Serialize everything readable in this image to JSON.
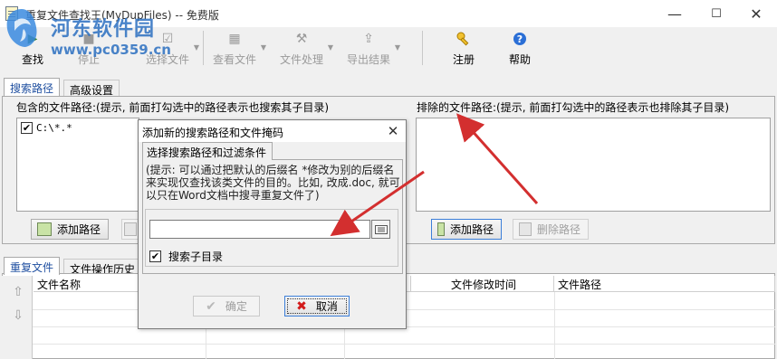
{
  "window": {
    "title": "重复文件查找王(MyDupFiles) -- 免费版",
    "minimize_glyph": "—",
    "maximize_glyph": "☐",
    "close_glyph": "✕"
  },
  "watermark": {
    "title": "河东软件园",
    "url": "www.pc0359.cn"
  },
  "toolbar": {
    "find": {
      "label": "查找",
      "icon": "play-icon"
    },
    "stop": {
      "label": "停止",
      "icon": "stop-icon"
    },
    "select_files": {
      "label": "选择文件",
      "icon": "checkbox-list-icon"
    },
    "view_files": {
      "label": "查看文件",
      "icon": "grid-icon"
    },
    "file_process": {
      "label": "文件处理",
      "icon": "tools-icon"
    },
    "export": {
      "label": "导出结果",
      "icon": "export-icon"
    },
    "register": {
      "label": "注册",
      "icon": "key-icon"
    },
    "help": {
      "label": "帮助",
      "icon": "help-icon"
    }
  },
  "top_tabs": {
    "search_path": "搜索路径",
    "advanced": "高级设置"
  },
  "include": {
    "label": "包含的文件路径:(提示, 前面打勾选中的路径表示也搜索其子目录)",
    "items": [
      {
        "checked": "✔",
        "path": "C:\\*.*"
      }
    ],
    "add_button": "添加路径"
  },
  "exclude": {
    "label": "排除的文件路径:(提示, 前面打勾选中的路径表示也排除其子目录)",
    "add_button": "添加路径",
    "delete_button": "删除路径"
  },
  "bottom_tabs": {
    "duplicates": "重复文件",
    "history": "文件操作历史"
  },
  "columns": {
    "name": "文件名称",
    "modified": "文件修改时间",
    "path": "文件路径"
  },
  "dialog": {
    "title": "添加新的搜索路径和文件掩码",
    "close_glyph": "✕",
    "tab": "选择搜索路径和过滤条件",
    "hint": "(提示: 可以通过把默认的后缀名 *修改为别的后缀名来实现仅查找该类文件的目的。比如, 改成.doc, 就可以只在Word文档中搜寻重复文件了)",
    "path_value": "",
    "include_subdirs": {
      "label": "搜索子目录",
      "check": "✔"
    },
    "ok": "确定",
    "cancel": "取消"
  },
  "colors": {
    "accent": "#1f4fa0",
    "arrow": "#d32f2f",
    "watermark": "#2b6fc1"
  }
}
